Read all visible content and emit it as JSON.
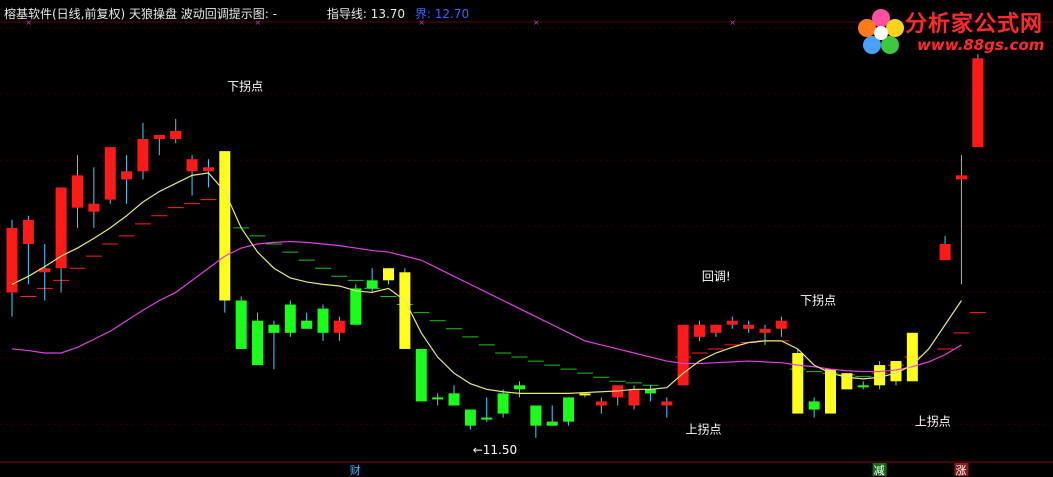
{
  "header": {
    "title": "榕基软件(日线,前复权) 天狼操盘 波动回调提示图: -",
    "guide_label": "指导线: 13.70",
    "bound_label": "界: 12.70"
  },
  "logo": {
    "name": "分析家公式网",
    "url": "www.88gs.com"
  },
  "colors": {
    "up": "#ff1a1a",
    "down": "#1aff1a",
    "highlight": "#ffff1a",
    "ma_yellow": "#e8e878",
    "ma_magenta": "#e040e0",
    "guide_red": "#ff2020",
    "guide_green": "#20c020"
  },
  "chart_data": {
    "type": "candlestick",
    "y_scale": "linear",
    "ylim": [
      11.0,
      16.4
    ],
    "candles": [
      {
        "o": 13.1,
        "h": 14.0,
        "l": 12.8,
        "c": 13.9,
        "color": "up"
      },
      {
        "o": 13.7,
        "h": 14.05,
        "l": 13.2,
        "c": 14.0,
        "color": "up"
      },
      {
        "o": 13.35,
        "h": 13.7,
        "l": 13.0,
        "c": 13.4,
        "color": "up"
      },
      {
        "o": 13.4,
        "h": 14.35,
        "l": 13.1,
        "c": 14.4,
        "color": "up"
      },
      {
        "o": 14.15,
        "h": 14.8,
        "l": 13.9,
        "c": 14.55,
        "color": "up"
      },
      {
        "o": 14.2,
        "h": 14.65,
        "l": 13.9,
        "c": 14.1,
        "color": "up"
      },
      {
        "o": 14.25,
        "h": 14.7,
        "l": 14.2,
        "c": 14.9,
        "color": "up"
      },
      {
        "o": 14.5,
        "h": 14.8,
        "l": 14.2,
        "c": 14.6,
        "color": "up"
      },
      {
        "o": 14.6,
        "h": 15.2,
        "l": 14.5,
        "c": 15.0,
        "color": "up"
      },
      {
        "o": 15.0,
        "h": 15.05,
        "l": 14.8,
        "c": 15.05,
        "color": "up"
      },
      {
        "o": 15.1,
        "h": 15.25,
        "l": 14.95,
        "c": 15.0,
        "color": "up"
      },
      {
        "o": 14.6,
        "h": 14.8,
        "l": 14.3,
        "c": 14.75,
        "color": "up"
      },
      {
        "o": 14.6,
        "h": 14.75,
        "l": 14.4,
        "c": 14.65,
        "color": "up"
      },
      {
        "o": 14.85,
        "h": 14.85,
        "l": 12.85,
        "c": 13.0,
        "color": "highlight"
      },
      {
        "o": 13.0,
        "h": 13.05,
        "l": 12.4,
        "c": 12.4,
        "color": "down"
      },
      {
        "o": 12.75,
        "h": 12.85,
        "l": 12.2,
        "c": 12.2,
        "color": "down"
      },
      {
        "o": 12.7,
        "h": 12.75,
        "l": 12.15,
        "c": 12.6,
        "color": "down"
      },
      {
        "o": 12.95,
        "h": 13.0,
        "l": 12.55,
        "c": 12.6,
        "color": "down"
      },
      {
        "o": 12.75,
        "h": 12.85,
        "l": 12.65,
        "c": 12.65,
        "color": "down"
      },
      {
        "o": 12.9,
        "h": 12.95,
        "l": 12.5,
        "c": 12.6,
        "color": "down"
      },
      {
        "o": 12.6,
        "h": 12.8,
        "l": 12.5,
        "c": 12.75,
        "color": "up"
      },
      {
        "o": 13.15,
        "h": 13.2,
        "l": 12.7,
        "c": 12.7,
        "color": "down"
      },
      {
        "o": 13.25,
        "h": 13.4,
        "l": 13.1,
        "c": 13.15,
        "color": "down"
      },
      {
        "o": 13.25,
        "h": 13.4,
        "l": 13.2,
        "c": 13.4,
        "color": "highlight"
      },
      {
        "o": 13.35,
        "h": 13.4,
        "l": 12.4,
        "c": 12.4,
        "color": "highlight"
      },
      {
        "o": 12.4,
        "h": 12.4,
        "l": 11.75,
        "c": 11.75,
        "color": "down"
      },
      {
        "o": 11.8,
        "h": 11.85,
        "l": 11.7,
        "c": 11.8,
        "color": "down"
      },
      {
        "o": 11.85,
        "h": 11.95,
        "l": 11.7,
        "c": 11.7,
        "color": "down"
      },
      {
        "o": 11.65,
        "h": 11.65,
        "l": 11.4,
        "c": 11.45,
        "color": "down"
      },
      {
        "o": 11.55,
        "h": 11.8,
        "l": 11.5,
        "c": 11.55,
        "color": "down"
      },
      {
        "o": 11.85,
        "h": 11.9,
        "l": 11.55,
        "c": 11.6,
        "color": "down"
      },
      {
        "o": 11.95,
        "h": 12.0,
        "l": 11.8,
        "c": 11.9,
        "color": "down"
      },
      {
        "o": 11.7,
        "h": 11.7,
        "l": 11.3,
        "c": 11.45,
        "color": "down"
      },
      {
        "o": 11.5,
        "h": 11.7,
        "l": 11.45,
        "c": 11.45,
        "color": "down"
      },
      {
        "o": 11.8,
        "h": 11.8,
        "l": 11.45,
        "c": 11.5,
        "color": "down"
      },
      {
        "o": 11.85,
        "h": 11.85,
        "l": 11.8,
        "c": 11.85,
        "color": "highlight"
      },
      {
        "o": 11.7,
        "h": 11.8,
        "l": 11.6,
        "c": 11.75,
        "color": "up"
      },
      {
        "o": 11.8,
        "h": 11.95,
        "l": 11.7,
        "c": 11.95,
        "color": "up"
      },
      {
        "o": 11.7,
        "h": 11.95,
        "l": 11.65,
        "c": 11.9,
        "color": "up"
      },
      {
        "o": 11.9,
        "h": 11.95,
        "l": 11.75,
        "c": 11.85,
        "color": "down"
      },
      {
        "o": 11.7,
        "h": 11.8,
        "l": 11.55,
        "c": 11.75,
        "color": "up"
      },
      {
        "o": 11.95,
        "h": 12.7,
        "l": 11.95,
        "c": 12.7,
        "color": "up"
      },
      {
        "o": 12.55,
        "h": 12.75,
        "l": 12.5,
        "c": 12.7,
        "color": "up"
      },
      {
        "o": 12.6,
        "h": 12.7,
        "l": 12.55,
        "c": 12.7,
        "color": "up"
      },
      {
        "o": 12.7,
        "h": 12.8,
        "l": 12.65,
        "c": 12.75,
        "color": "up"
      },
      {
        "o": 12.65,
        "h": 12.75,
        "l": 12.6,
        "c": 12.7,
        "color": "up"
      },
      {
        "o": 12.6,
        "h": 12.7,
        "l": 12.45,
        "c": 12.65,
        "color": "up"
      },
      {
        "o": 12.65,
        "h": 12.8,
        "l": 12.55,
        "c": 12.75,
        "color": "up"
      },
      {
        "o": 12.35,
        "h": 12.4,
        "l": 11.6,
        "c": 11.6,
        "color": "highlight"
      },
      {
        "o": 11.75,
        "h": 11.8,
        "l": 11.55,
        "c": 11.65,
        "color": "down"
      },
      {
        "o": 12.15,
        "h": 12.15,
        "l": 11.6,
        "c": 11.6,
        "color": "highlight"
      },
      {
        "o": 11.9,
        "h": 12.1,
        "l": 11.9,
        "c": 12.1,
        "color": "highlight"
      },
      {
        "o": 11.95,
        "h": 12.0,
        "l": 11.9,
        "c": 11.95,
        "color": "down"
      },
      {
        "o": 11.95,
        "h": 12.25,
        "l": 11.9,
        "c": 12.2,
        "color": "highlight"
      },
      {
        "o": 12.0,
        "h": 12.25,
        "l": 11.95,
        "c": 12.25,
        "color": "highlight"
      },
      {
        "o": 12.0,
        "h": 12.6,
        "l": 12.0,
        "c": 12.6,
        "color": "highlight"
      },
      {
        "o": null,
        "h": null,
        "l": null,
        "c": null,
        "color": "none"
      },
      {
        "o": 13.7,
        "h": 13.8,
        "l": 13.5,
        "c": 13.5,
        "color": "up"
      },
      {
        "o": 14.5,
        "h": 14.8,
        "l": 13.2,
        "c": 14.55,
        "color": "up"
      },
      {
        "o": 14.9,
        "h": 16.05,
        "l": 14.9,
        "c": 16.0,
        "color": "up"
      }
    ],
    "ma_yellow": [
      13.2,
      13.3,
      13.42,
      13.55,
      13.65,
      13.77,
      13.9,
      14.05,
      14.22,
      14.35,
      14.45,
      14.55,
      14.58,
      14.35,
      13.9,
      13.6,
      13.4,
      13.28,
      13.23,
      13.2,
      13.18,
      13.12,
      13.1,
      13.15,
      13.0,
      12.6,
      12.3,
      12.1,
      11.97,
      11.9,
      11.87,
      11.85,
      11.85,
      11.85,
      11.85,
      11.86,
      11.87,
      11.88,
      11.9,
      11.9,
      11.92,
      12.1,
      12.25,
      12.35,
      12.42,
      12.48,
      12.5,
      12.5,
      12.4,
      12.2,
      12.1,
      12.05,
      12.03,
      12.05,
      12.1,
      12.2,
      12.4,
      12.7,
      13.0
    ],
    "ma_magenta": [
      12.4,
      12.38,
      12.35,
      12.35,
      12.42,
      12.52,
      12.62,
      12.75,
      12.88,
      13.0,
      13.1,
      13.25,
      13.4,
      13.55,
      13.65,
      13.7,
      13.72,
      13.73,
      13.72,
      13.7,
      13.68,
      13.65,
      13.62,
      13.6,
      13.55,
      13.5,
      13.4,
      13.3,
      13.2,
      13.1,
      13.0,
      12.9,
      12.8,
      12.7,
      12.6,
      12.5,
      12.45,
      12.4,
      12.35,
      12.3,
      12.25,
      12.22,
      12.22,
      12.23,
      12.24,
      12.25,
      12.24,
      12.23,
      12.2,
      12.18,
      12.15,
      12.13,
      12.12,
      12.12,
      12.14,
      12.18,
      12.24,
      12.33,
      12.45
    ],
    "guide_steps": [
      {
        "i": 1,
        "v": 13.05,
        "color": "guide_red"
      },
      {
        "i": 2,
        "v": 13.15,
        "color": "guide_red"
      },
      {
        "i": 3,
        "v": 13.25,
        "color": "guide_red"
      },
      {
        "i": 4,
        "v": 13.4,
        "color": "guide_red"
      },
      {
        "i": 5,
        "v": 13.55,
        "color": "guide_red"
      },
      {
        "i": 6,
        "v": 13.7,
        "color": "guide_red"
      },
      {
        "i": 7,
        "v": 13.8,
        "color": "guide_red"
      },
      {
        "i": 8,
        "v": 13.95,
        "color": "guide_red"
      },
      {
        "i": 9,
        "v": 14.05,
        "color": "guide_red"
      },
      {
        "i": 10,
        "v": 14.15,
        "color": "guide_red"
      },
      {
        "i": 11,
        "v": 14.2,
        "color": "guide_red"
      },
      {
        "i": 12,
        "v": 14.25,
        "color": "guide_red"
      },
      {
        "i": 14,
        "v": 13.9,
        "color": "guide_green"
      },
      {
        "i": 15,
        "v": 13.8,
        "color": "guide_green"
      },
      {
        "i": 16,
        "v": 13.7,
        "color": "guide_green"
      },
      {
        "i": 17,
        "v": 13.6,
        "color": "guide_green"
      },
      {
        "i": 18,
        "v": 13.5,
        "color": "guide_green"
      },
      {
        "i": 19,
        "v": 13.4,
        "color": "guide_green"
      },
      {
        "i": 20,
        "v": 13.3,
        "color": "guide_green"
      },
      {
        "i": 21,
        "v": 13.25,
        "color": "guide_green"
      },
      {
        "i": 22,
        "v": 13.15,
        "color": "guide_green"
      },
      {
        "i": 23,
        "v": 13.05,
        "color": "guide_green"
      },
      {
        "i": 24,
        "v": 12.95,
        "color": "guide_green"
      },
      {
        "i": 25,
        "v": 12.85,
        "color": "guide_green"
      },
      {
        "i": 26,
        "v": 12.75,
        "color": "guide_green"
      },
      {
        "i": 27,
        "v": 12.65,
        "color": "guide_green"
      },
      {
        "i": 28,
        "v": 12.55,
        "color": "guide_green"
      },
      {
        "i": 29,
        "v": 12.45,
        "color": "guide_green"
      },
      {
        "i": 30,
        "v": 12.35,
        "color": "guide_green"
      },
      {
        "i": 31,
        "v": 12.3,
        "color": "guide_green"
      },
      {
        "i": 32,
        "v": 12.25,
        "color": "guide_green"
      },
      {
        "i": 33,
        "v": 12.2,
        "color": "guide_green"
      },
      {
        "i": 34,
        "v": 12.15,
        "color": "guide_green"
      },
      {
        "i": 35,
        "v": 12.1,
        "color": "guide_green"
      },
      {
        "i": 36,
        "v": 12.05,
        "color": "guide_green"
      },
      {
        "i": 37,
        "v": 12.0,
        "color": "guide_green"
      },
      {
        "i": 38,
        "v": 11.98,
        "color": "guide_green"
      },
      {
        "i": 39,
        "v": 11.95,
        "color": "guide_green"
      },
      {
        "i": 41,
        "v": 12.3,
        "color": "guide_red"
      },
      {
        "i": 42,
        "v": 12.35,
        "color": "guide_red"
      },
      {
        "i": 43,
        "v": 12.4,
        "color": "guide_red"
      },
      {
        "i": 44,
        "v": 12.45,
        "color": "guide_red"
      },
      {
        "i": 45,
        "v": 12.48,
        "color": "guide_red"
      },
      {
        "i": 46,
        "v": 12.5,
        "color": "guide_red"
      },
      {
        "i": 47,
        "v": 12.5,
        "color": "guide_red"
      },
      {
        "i": 48,
        "v": 12.15,
        "color": "guide_green"
      },
      {
        "i": 49,
        "v": 12.12,
        "color": "guide_green"
      },
      {
        "i": 50,
        "v": 12.1,
        "color": "guide_green"
      },
      {
        "i": 51,
        "v": 12.08,
        "color": "guide_green"
      },
      {
        "i": 52,
        "v": 12.06,
        "color": "guide_green"
      },
      {
        "i": 53,
        "v": 12.1,
        "color": "guide_red"
      },
      {
        "i": 54,
        "v": 12.2,
        "color": "guide_red"
      },
      {
        "i": 55,
        "v": 12.3,
        "color": "guide_red"
      },
      {
        "i": 57,
        "v": 12.4,
        "color": "guide_red"
      },
      {
        "i": 58,
        "v": 12.6,
        "color": "guide_red"
      },
      {
        "i": 59,
        "v": 12.85,
        "color": "guide_red"
      }
    ],
    "annotations": [
      {
        "text": "下拐点",
        "i": 14,
        "v": 15.6
      },
      {
        "text": "回调!",
        "i": 43,
        "v": 13.25
      },
      {
        "text": "下拐点",
        "i": 49,
        "v": 12.95
      },
      {
        "text": "上拐点",
        "i": 42,
        "v": 11.35
      },
      {
        "text": "上拐点",
        "i": 56,
        "v": 11.45
      },
      {
        "text": "←11.50",
        "i": 29,
        "v": 11.1
      }
    ],
    "bottom_markers": [
      {
        "text": "财",
        "i": 21,
        "color": "#4ab0ff",
        "bg": "transparent"
      },
      {
        "text": "减",
        "i": 53,
        "color": "#ffffff",
        "bg": "#1a6a1a"
      },
      {
        "text": "涨",
        "i": 58,
        "color": "#ffffff",
        "bg": "#8a1a1a"
      }
    ],
    "top_markers": [
      1,
      15,
      25,
      32,
      44
    ]
  }
}
